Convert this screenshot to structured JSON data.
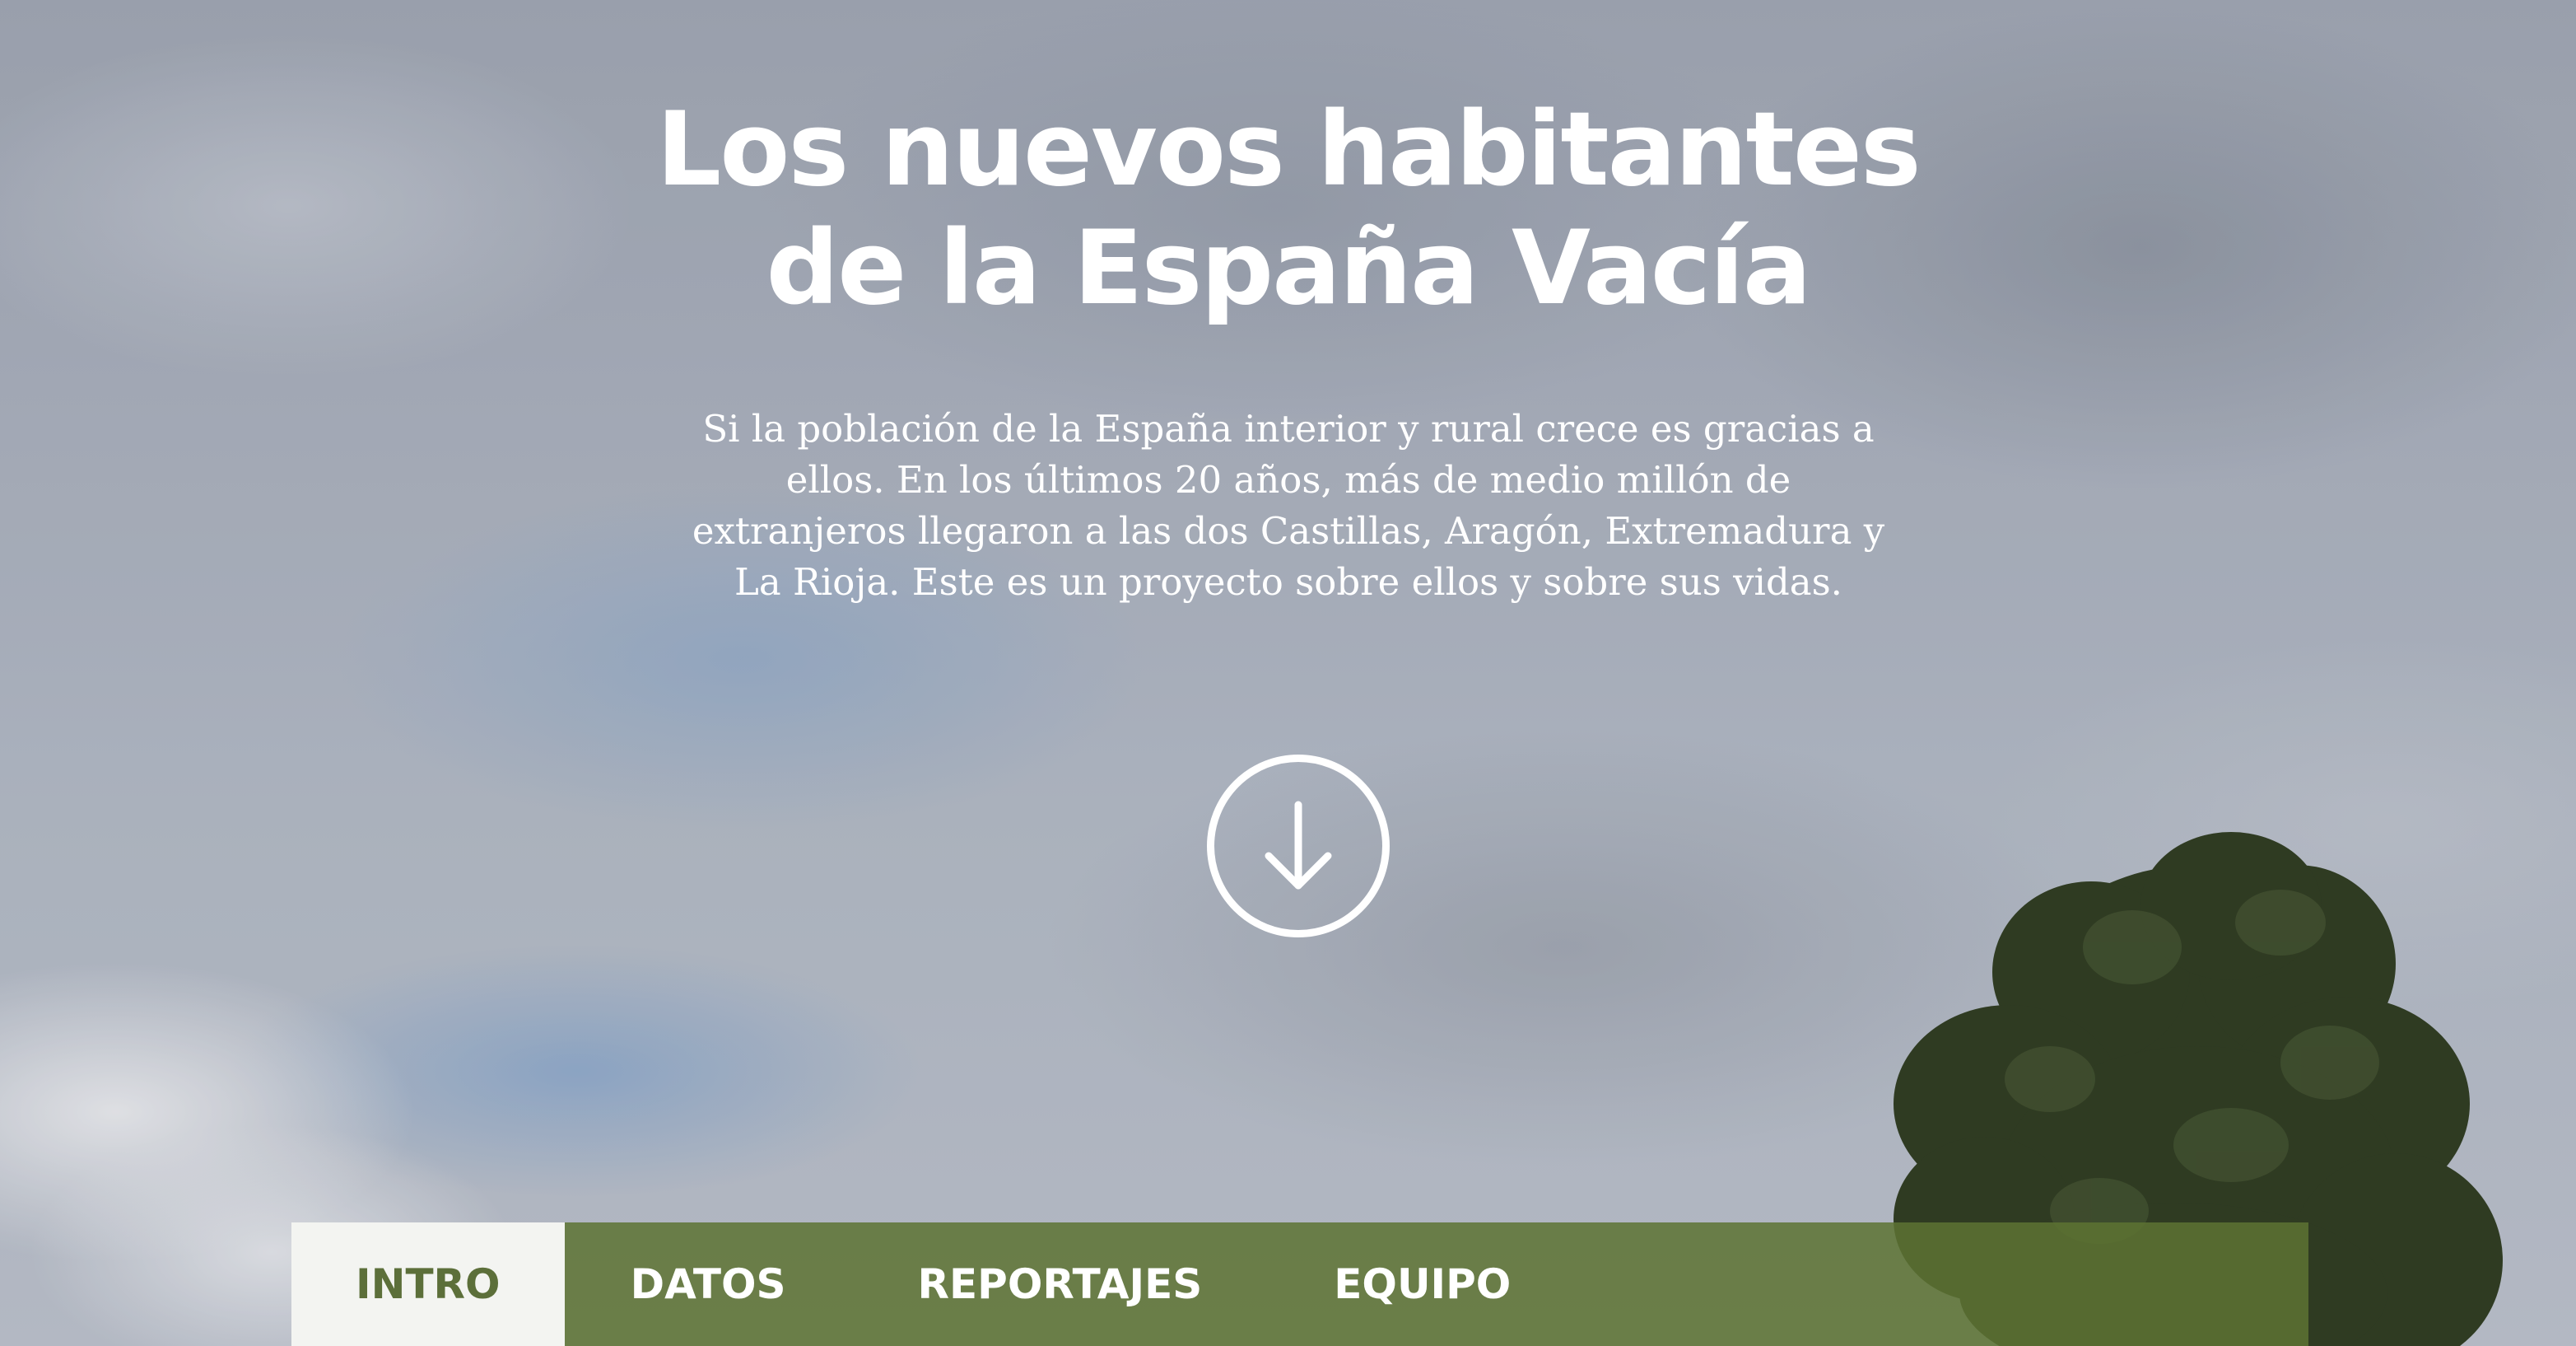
{
  "hero": {
    "title_line1": "Los nuevos habitantes",
    "title_line2": "de la España Vacía",
    "intro": "Si la población de la España interior y rural crece es gracias a ellos. En los últimos 20 años, más de medio millón de extranjeros llegaron a las dos Castillas, Aragón, Extremadura y La Rioja. Este es un proyecto sobre ellos y sobre sus vidas.",
    "scroll_icon": "arrow-down-circle-icon"
  },
  "nav": {
    "items": [
      {
        "label": "INTRO",
        "active": true
      },
      {
        "label": "DATOS",
        "active": false
      },
      {
        "label": "REPORTAJES",
        "active": false
      },
      {
        "label": "EQUIPO",
        "active": false
      }
    ]
  },
  "colors": {
    "nav_background": "#5d7333",
    "nav_active_background": "#f3f4f1",
    "nav_active_text": "#5c6f3a",
    "text": "#ffffff"
  }
}
